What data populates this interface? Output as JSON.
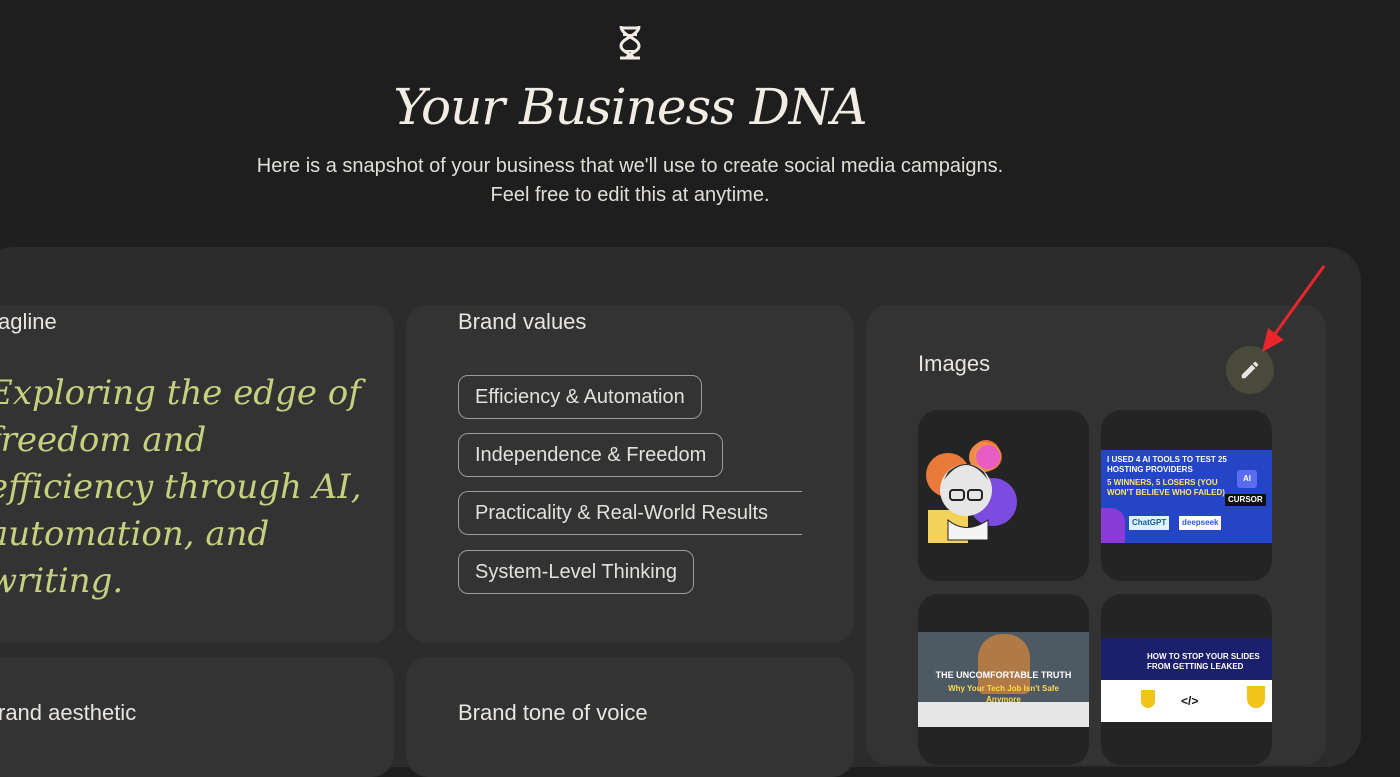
{
  "header": {
    "icon": "dna-icon",
    "title": "Your Business DNA",
    "subtitle_line1": "Here is a snapshot of your business that we'll use to create social media campaigns.",
    "subtitle_line2": "Feel free to edit this at anytime."
  },
  "tagline_card": {
    "label": "agline",
    "text": "Exploring the edge of freedom and efficiency through AI, automation, and writing."
  },
  "values_card": {
    "label": "Brand values",
    "chips": [
      "Efficiency & Automation",
      "Independence & Freedom",
      "Practicality & Real-World Results",
      "System-Level Thinking"
    ]
  },
  "images_card": {
    "label": "Images",
    "edit_icon": "pencil-icon",
    "thumb2": {
      "line1": "I USED 4 AI TOOLS TO TEST 25",
      "line2": "HOSTING PROVIDERS",
      "line3": "5 WINNERS, 5 LOSERS (YOU",
      "line4": "WON'T BELIEVE WHO FAILED)",
      "badge_ai": "AI",
      "badge_cursor": "CURSOR",
      "chip1": "ChatGPT",
      "chip2": "deepseek"
    },
    "thumb3": {
      "line1": "THE UNCOMFORTABLE TRUTH",
      "line2": "Why Your Tech Job Isn't Safe",
      "line3": "Anymore"
    },
    "thumb4": {
      "line1": "HOW TO STOP YOUR SLIDES",
      "line2": "FROM GETTING LEAKED"
    }
  },
  "aesthetic_card": {
    "label": "rand aesthetic"
  },
  "tone_card": {
    "label": "Brand tone of voice"
  },
  "colors": {
    "background": "#1e1e1e",
    "panel": "#2c2c2c",
    "card": "#333333",
    "tagline_accent": "#c7d07f",
    "arrow": "#e8262c"
  }
}
